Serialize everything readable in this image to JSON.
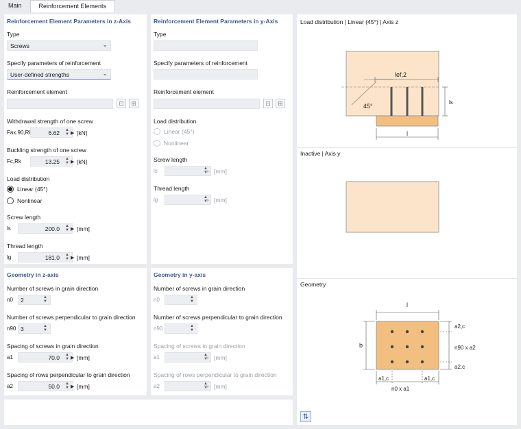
{
  "tabs": [
    {
      "label": "Main"
    },
    {
      "label": "Reinforcement Elements"
    }
  ],
  "z": {
    "section_title": "Reinforcement Element Parameters in z-Axis",
    "type_label": "Type",
    "type_value": "Screws",
    "specify_label": "Specify parameters of reinforcement",
    "specify_value": "User-defined strengths",
    "element_label": "Reinforcement element",
    "withdrawal_label": "Withdrawal strength of one screw",
    "withdrawal_sym": "Fax.90,Rk",
    "withdrawal_value": "6.62",
    "withdrawal_unit": "[kN]",
    "buckling_label": "Buckling strength of one screw",
    "buckling_sym": "Fc,Rk",
    "buckling_value": "13.25",
    "buckling_unit": "[kN]",
    "load_label": "Load distribution",
    "load_opt1": "Linear (45°)",
    "load_opt2": "Nonlinear",
    "screw_len_label": "Screw length",
    "screw_len_sym": "ls",
    "screw_len_value": "200.0",
    "screw_len_unit": "[mm]",
    "thread_label": "Thread length",
    "thread_sym": "lg",
    "thread_value": "181.0",
    "thread_unit": "[mm]"
  },
  "y": {
    "section_title": "Reinforcement Element Parameters in y-Axis",
    "type_label": "Type",
    "specify_label": "Specify parameters of reinforcement",
    "element_label": "Reinforcement element",
    "load_label": "Load distribution",
    "load_opt1": "Linear (45°)",
    "load_opt2": "Nonlinear",
    "screw_len_label": "Screw length",
    "screw_len_sym": "ls",
    "screw_len_unit": "[mm]",
    "thread_label": "Thread length",
    "thread_sym": "lg",
    "thread_unit": "[mm]"
  },
  "gz": {
    "section_title": "Geometry in z-axis",
    "n0_label": "Number of screws in grain direction",
    "n0_sym": "n0",
    "n0_value": "2",
    "n90_label": "Number of screws perpendicular to grain direction",
    "n90_sym": "n90",
    "n90_value": "3",
    "a1_label": "Spacing of screws in grain direction",
    "a1_sym": "a1",
    "a1_value": "70.0",
    "a1_unit": "[mm]",
    "a2_label": "Spacing of rows perpendicular to grain direction",
    "a2_sym": "a2",
    "a2_value": "50.0",
    "a2_unit": "[mm]"
  },
  "gy": {
    "section_title": "Geometry in y-axis",
    "n0_label": "Number of screws in grain direction",
    "n0_sym": "n0",
    "n90_label": "Number of screws perpendicular to grain direction",
    "n90_sym": "n90",
    "a1_label": "Spacing of screws in grain direction",
    "a1_sym": "a1",
    "a1_unit": "[mm]",
    "a2_label": "Spacing of rows perpendicular to grain direction",
    "a2_sym": "a2",
    "a2_unit": "[mm]"
  },
  "graphics": {
    "load_title": "Load distribution | Linear (45°) | Axis z",
    "inactive_title": "Inactive | Axis y",
    "geometry_title": "Geometry",
    "lbl_lef2": "lef,2",
    "lbl_45": "45°",
    "lbl_ls": "ls",
    "lbl_l": "l",
    "lbl_gl": "l",
    "lbl_b": "b",
    "lbl_a2c_top": "a2,c",
    "lbl_n90a2": "n90 x a2",
    "lbl_a2c_bot": "a2,c",
    "lbl_a1c_l": "a1,c",
    "lbl_a1c_r": "a1,c",
    "lbl_n0a1": "n0 x a1"
  },
  "colors": {
    "wood": "#fbe4c9",
    "steel": "#f3bf80",
    "screw": "#555555",
    "accent": "#3c5a8c"
  }
}
